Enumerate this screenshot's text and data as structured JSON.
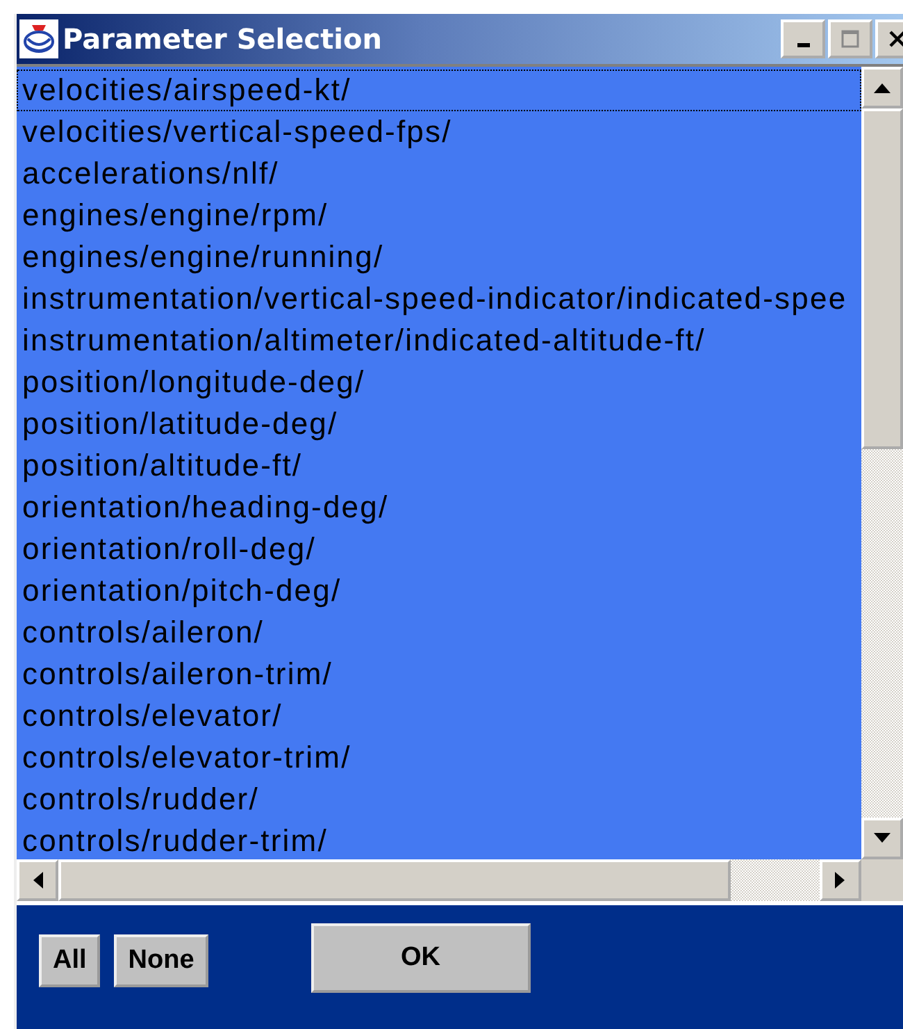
{
  "window": {
    "title": "Parameter Selection"
  },
  "parameters": [
    {
      "text": "velocities/airspeed-kt/",
      "selected": true,
      "focused": true
    },
    {
      "text": "velocities/vertical-speed-fps/",
      "selected": true,
      "focused": false
    },
    {
      "text": "accelerations/nlf/",
      "selected": true,
      "focused": false
    },
    {
      "text": "engines/engine/rpm/",
      "selected": true,
      "focused": false
    },
    {
      "text": "engines/engine/running/",
      "selected": true,
      "focused": false
    },
    {
      "text": "instrumentation/vertical-speed-indicator/indicated-spee",
      "selected": true,
      "focused": false
    },
    {
      "text": "instrumentation/altimeter/indicated-altitude-ft/",
      "selected": true,
      "focused": false
    },
    {
      "text": "position/longitude-deg/",
      "selected": true,
      "focused": false
    },
    {
      "text": "position/latitude-deg/",
      "selected": true,
      "focused": false
    },
    {
      "text": "position/altitude-ft/",
      "selected": true,
      "focused": false
    },
    {
      "text": "orientation/heading-deg/",
      "selected": true,
      "focused": false
    },
    {
      "text": "orientation/roll-deg/",
      "selected": true,
      "focused": false
    },
    {
      "text": "orientation/pitch-deg/",
      "selected": true,
      "focused": false
    },
    {
      "text": "controls/aileron/",
      "selected": true,
      "focused": false
    },
    {
      "text": "controls/aileron-trim/",
      "selected": true,
      "focused": false
    },
    {
      "text": "controls/elevator/",
      "selected": true,
      "focused": false
    },
    {
      "text": "controls/elevator-trim/",
      "selected": true,
      "focused": false
    },
    {
      "text": "controls/rudder/",
      "selected": true,
      "focused": false
    },
    {
      "text": "controls/rudder-trim/",
      "selected": true,
      "focused": false
    }
  ],
  "buttons": {
    "select_all": "All",
    "select_none": "None",
    "ok": "OK"
  }
}
